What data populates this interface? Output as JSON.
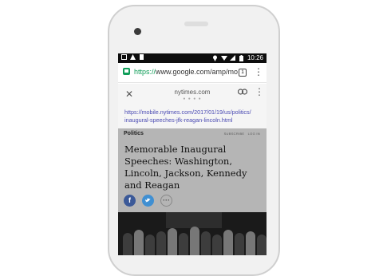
{
  "status_bar": {
    "time": "10:26"
  },
  "browser": {
    "url_scheme": "https://",
    "url_rest": "www.google.com/amp/mo",
    "tab_count": "1"
  },
  "amp_header": {
    "domain": "nytimes.com",
    "full_url_line1": "https://mobile.nytimes.com/2017/01/19/us/politics/",
    "full_url_line2": "inaugural-speeches-jfk-reagan-lincoln.html"
  },
  "article": {
    "section": "Politics",
    "subscribe": "SUBSCRIBE",
    "login": "LOG IN",
    "headline": "Memorable Inaugural Speeches: Washington, Lincoln, Jackson, Kennedy and Reagan"
  },
  "share": {
    "facebook": "f",
    "more": "···"
  }
}
